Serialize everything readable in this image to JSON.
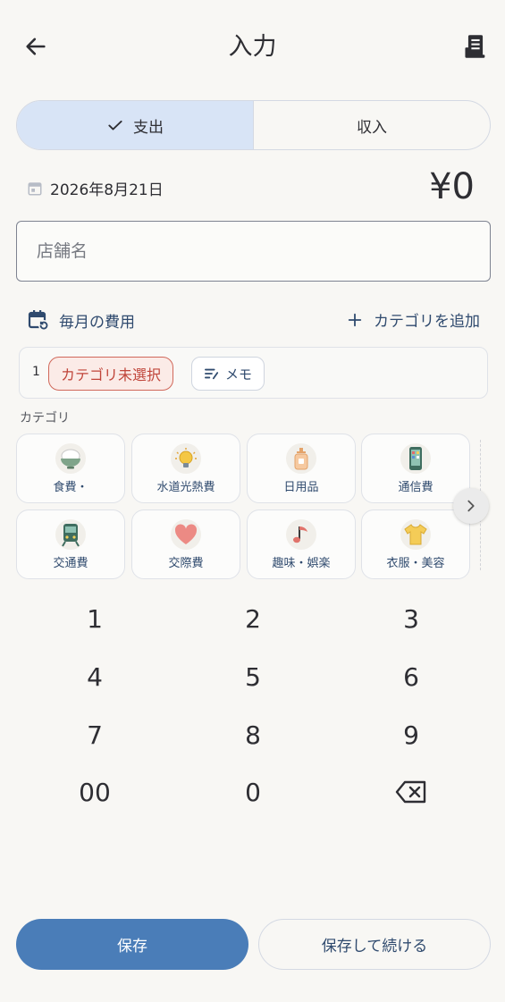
{
  "header": {
    "title": "入力",
    "back_icon": "arrow-left-icon",
    "receipt_icon": "receipt-icon"
  },
  "type_toggle": {
    "expense_label": "支出",
    "income_label": "収入",
    "selected": "expense"
  },
  "date": {
    "text": "2026年8月21日"
  },
  "amount": {
    "text": "¥0"
  },
  "store": {
    "placeholder": "店舗名",
    "value": ""
  },
  "actions": {
    "monthly_label": "毎月の費用",
    "add_category_label": "カテゴリを追加"
  },
  "row": {
    "number": "1",
    "uncategorized_label": "カテゴリ未選択",
    "memo_label": "メモ"
  },
  "categories": {
    "label": "カテゴリ",
    "items": [
      {
        "label": "食費・",
        "icon": "rice-bowl-icon"
      },
      {
        "label": "水道光熱費",
        "icon": "light-bulb-icon"
      },
      {
        "label": "日用品",
        "icon": "soap-bottle-icon"
      },
      {
        "label": "通信費",
        "icon": "smartphone-icon"
      },
      {
        "label": "交通費",
        "icon": "train-icon"
      },
      {
        "label": "交際費",
        "icon": "heart-icon"
      },
      {
        "label": "趣味・娯楽",
        "icon": "music-note-icon"
      },
      {
        "label": "衣服・美容",
        "icon": "t-shirt-icon"
      }
    ]
  },
  "keypad": {
    "keys": [
      "1",
      "2",
      "3",
      "4",
      "5",
      "6",
      "7",
      "8",
      "9",
      "00",
      "0"
    ]
  },
  "buttons": {
    "save_label": "保存",
    "save_continue_label": "保存して続ける"
  },
  "colors": {
    "accent": "#4a7db8",
    "selected_segment": "#d8e4f6",
    "alert": "#c0453a"
  }
}
